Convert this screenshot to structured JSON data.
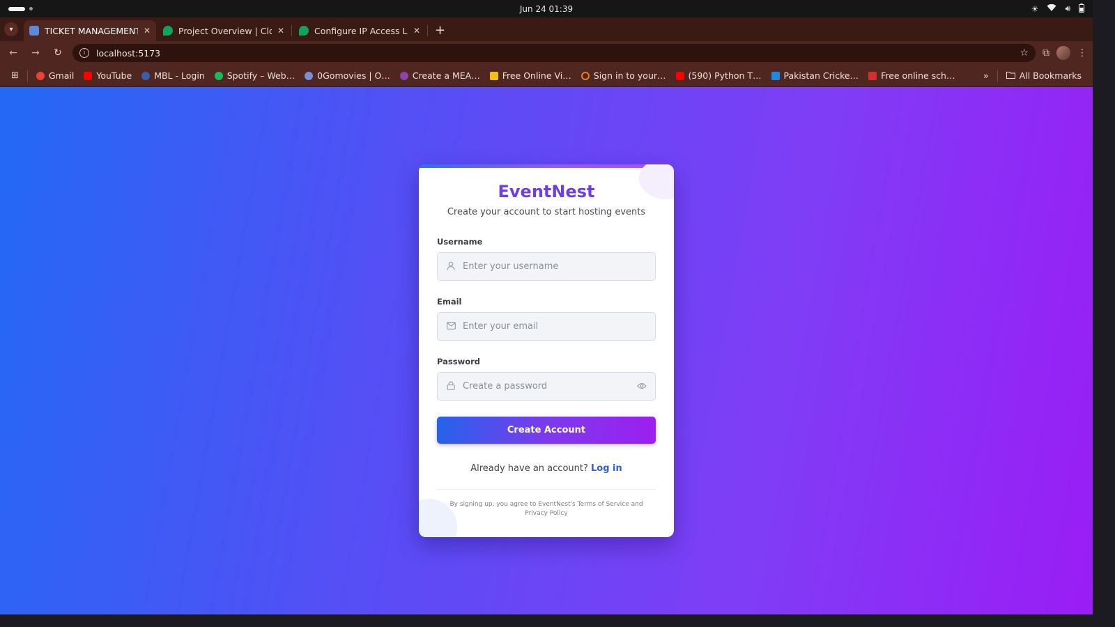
{
  "os": {
    "clock": "Jun 24  01:39"
  },
  "tabs": [
    {
      "title": "TICKET MANAGEMENT",
      "active": true,
      "favicon_color": "#5c8ad6"
    },
    {
      "title": "Project Overview | Cloud",
      "active": false,
      "favicon_color": "#11a35a"
    },
    {
      "title": "Configure IP Access List |",
      "active": false,
      "favicon_color": "#11a35a"
    }
  ],
  "address_bar": {
    "url": "localhost:5173"
  },
  "bookmarks": [
    {
      "label": "Gmail",
      "color": "#ea4335"
    },
    {
      "label": "YouTube",
      "color": "#ff0000"
    },
    {
      "label": "MBL - Login",
      "color": "#3a5fa8"
    },
    {
      "label": "Spotify – Web…",
      "color": "#1db954"
    },
    {
      "label": "0Gomovies | O…",
      "color": "#7a8fd6"
    },
    {
      "label": "Create a MEA…",
      "color": "#8e44ad"
    },
    {
      "label": "Free Online Vi…",
      "color": "#f4c20d"
    },
    {
      "label": "Sign in to your…",
      "color": "#e67e22"
    },
    {
      "label": "(590) Python T…",
      "color": "#ff0000"
    },
    {
      "label": "Pakistan Cricke…",
      "color": "#1e88e5"
    },
    {
      "label": "Free online sch…",
      "color": "#d32f2f"
    }
  ],
  "bookmarks_more": "»",
  "all_bookmarks": "All Bookmarks",
  "card": {
    "brand": "EventNest",
    "subtitle": "Create your account to start hosting events",
    "username": {
      "label": "Username",
      "placeholder": "Enter your username"
    },
    "email": {
      "label": "Email",
      "placeholder": "Enter your email"
    },
    "password": {
      "label": "Password",
      "placeholder": "Create a password"
    },
    "submit_label": "Create Account",
    "login_prompt": "Already have an account?",
    "login_link": "Log in",
    "terms": "By signing up, you agree to EventNest's Terms of Service and Privacy Policy"
  },
  "colors": {
    "brand": "#6d3fe0",
    "link": "#2b5fd9",
    "page_gradient_start": "#2369f5",
    "page_gradient_end": "#9a1df5"
  }
}
